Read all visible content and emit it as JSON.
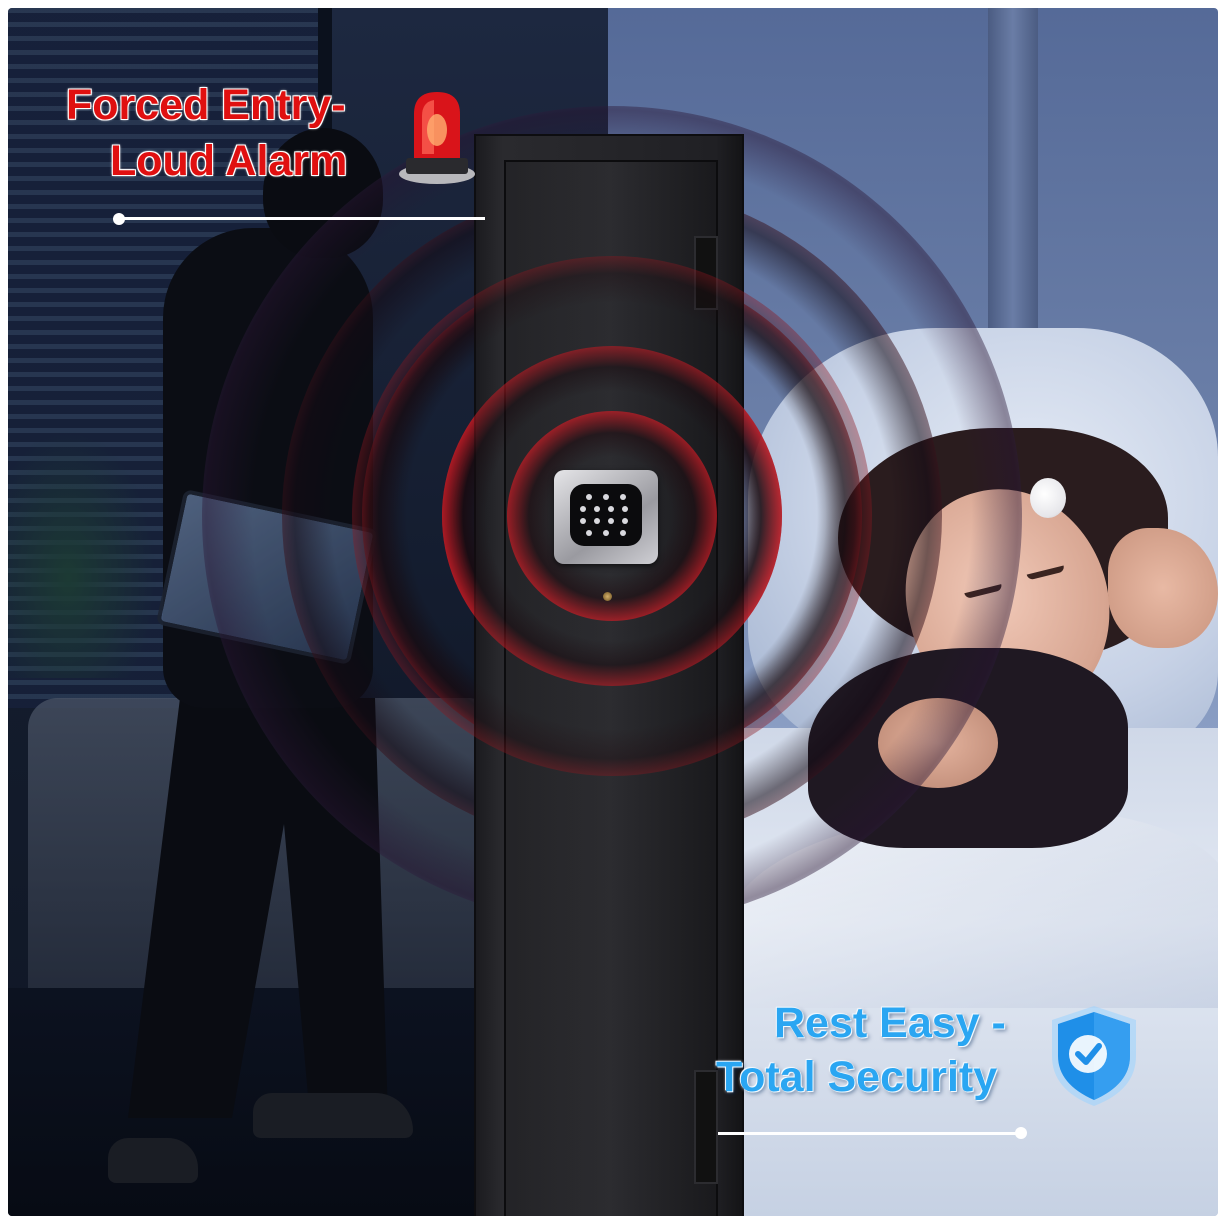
{
  "callouts": {
    "alarm": {
      "line1": "Forced Entry-",
      "line2": "Loud Alarm",
      "icon": "siren-icon",
      "color": "#e01010"
    },
    "security": {
      "line1": "Rest Easy -",
      "line2": "Total Security",
      "icon": "shield-check-icon",
      "color": "#2aa6f2"
    }
  }
}
